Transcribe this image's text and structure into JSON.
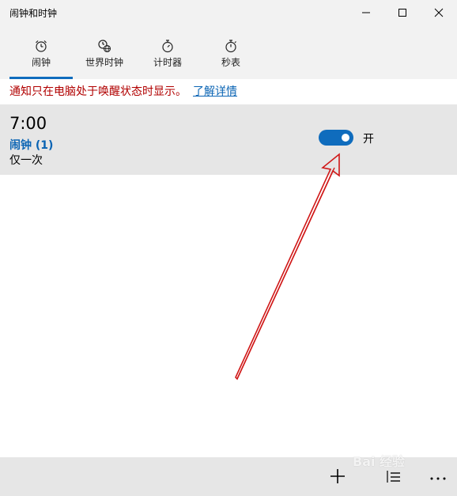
{
  "window": {
    "title": "闹钟和时钟"
  },
  "tabs": [
    {
      "label": "闹钟",
      "icon": "alarm-clock-icon",
      "active": true
    },
    {
      "label": "世界时钟",
      "icon": "world-clock-icon",
      "active": false
    },
    {
      "label": "计时器",
      "icon": "timer-icon",
      "active": false
    },
    {
      "label": "秒表",
      "icon": "stopwatch-icon",
      "active": false
    }
  ],
  "notice": {
    "text": "通知只在电脑处于唤醒状态时显示。",
    "link": "了解详情"
  },
  "alarms": [
    {
      "time": "7:00",
      "name": "闹钟 (1)",
      "repeat": "仅一次",
      "toggle_label": "开",
      "enabled": true
    }
  ],
  "watermark": "Bai 经验",
  "colors": {
    "accent": "#0f6cbd",
    "notice_red": "#b10000",
    "link_blue": "#0a64b4",
    "annotation_arrow": "#d01818"
  }
}
